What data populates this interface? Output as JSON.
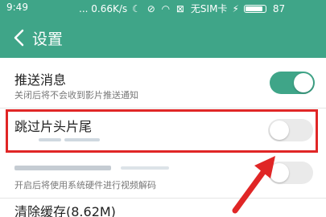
{
  "status": {
    "time": "9:49",
    "network": "... 0.66K/s",
    "sim": "无SIM卡",
    "battery_pct": "87",
    "battery_level": 0.87
  },
  "header": {
    "back_icon": "chevron-left-icon",
    "title": "设置"
  },
  "settings": [
    {
      "title": "推送消息",
      "subtitle": "关闭后将不会收到影片推送通知",
      "toggle": "on"
    },
    {
      "title": "跳过片头片尾",
      "subtitle": "",
      "toggle": "off"
    },
    {
      "title": "",
      "subtitle": "开启后将使用系统硬件进行视频解码",
      "toggle": "off"
    },
    {
      "title": "清除缓存(8.62M)",
      "subtitle": ""
    }
  ],
  "colors": {
    "accent": "#3fa588",
    "highlight": "#e02626"
  }
}
